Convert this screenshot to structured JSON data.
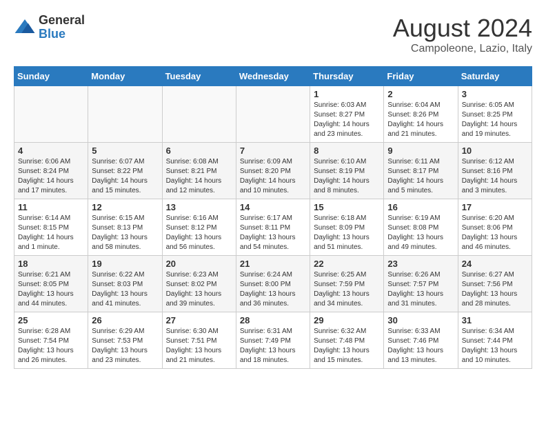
{
  "logo": {
    "general": "General",
    "blue": "Blue"
  },
  "title": {
    "month_year": "August 2024",
    "location": "Campoleone, Lazio, Italy"
  },
  "weekdays": [
    "Sunday",
    "Monday",
    "Tuesday",
    "Wednesday",
    "Thursday",
    "Friday",
    "Saturday"
  ],
  "weeks": [
    [
      {
        "day": "",
        "info": ""
      },
      {
        "day": "",
        "info": ""
      },
      {
        "day": "",
        "info": ""
      },
      {
        "day": "",
        "info": ""
      },
      {
        "day": "1",
        "info": "Sunrise: 6:03 AM\nSunset: 8:27 PM\nDaylight: 14 hours\nand 23 minutes."
      },
      {
        "day": "2",
        "info": "Sunrise: 6:04 AM\nSunset: 8:26 PM\nDaylight: 14 hours\nand 21 minutes."
      },
      {
        "day": "3",
        "info": "Sunrise: 6:05 AM\nSunset: 8:25 PM\nDaylight: 14 hours\nand 19 minutes."
      }
    ],
    [
      {
        "day": "4",
        "info": "Sunrise: 6:06 AM\nSunset: 8:24 PM\nDaylight: 14 hours\nand 17 minutes."
      },
      {
        "day": "5",
        "info": "Sunrise: 6:07 AM\nSunset: 8:22 PM\nDaylight: 14 hours\nand 15 minutes."
      },
      {
        "day": "6",
        "info": "Sunrise: 6:08 AM\nSunset: 8:21 PM\nDaylight: 14 hours\nand 12 minutes."
      },
      {
        "day": "7",
        "info": "Sunrise: 6:09 AM\nSunset: 8:20 PM\nDaylight: 14 hours\nand 10 minutes."
      },
      {
        "day": "8",
        "info": "Sunrise: 6:10 AM\nSunset: 8:19 PM\nDaylight: 14 hours\nand 8 minutes."
      },
      {
        "day": "9",
        "info": "Sunrise: 6:11 AM\nSunset: 8:17 PM\nDaylight: 14 hours\nand 5 minutes."
      },
      {
        "day": "10",
        "info": "Sunrise: 6:12 AM\nSunset: 8:16 PM\nDaylight: 14 hours\nand 3 minutes."
      }
    ],
    [
      {
        "day": "11",
        "info": "Sunrise: 6:14 AM\nSunset: 8:15 PM\nDaylight: 14 hours\nand 1 minute."
      },
      {
        "day": "12",
        "info": "Sunrise: 6:15 AM\nSunset: 8:13 PM\nDaylight: 13 hours\nand 58 minutes."
      },
      {
        "day": "13",
        "info": "Sunrise: 6:16 AM\nSunset: 8:12 PM\nDaylight: 13 hours\nand 56 minutes."
      },
      {
        "day": "14",
        "info": "Sunrise: 6:17 AM\nSunset: 8:11 PM\nDaylight: 13 hours\nand 54 minutes."
      },
      {
        "day": "15",
        "info": "Sunrise: 6:18 AM\nSunset: 8:09 PM\nDaylight: 13 hours\nand 51 minutes."
      },
      {
        "day": "16",
        "info": "Sunrise: 6:19 AM\nSunset: 8:08 PM\nDaylight: 13 hours\nand 49 minutes."
      },
      {
        "day": "17",
        "info": "Sunrise: 6:20 AM\nSunset: 8:06 PM\nDaylight: 13 hours\nand 46 minutes."
      }
    ],
    [
      {
        "day": "18",
        "info": "Sunrise: 6:21 AM\nSunset: 8:05 PM\nDaylight: 13 hours\nand 44 minutes."
      },
      {
        "day": "19",
        "info": "Sunrise: 6:22 AM\nSunset: 8:03 PM\nDaylight: 13 hours\nand 41 minutes."
      },
      {
        "day": "20",
        "info": "Sunrise: 6:23 AM\nSunset: 8:02 PM\nDaylight: 13 hours\nand 39 minutes."
      },
      {
        "day": "21",
        "info": "Sunrise: 6:24 AM\nSunset: 8:00 PM\nDaylight: 13 hours\nand 36 minutes."
      },
      {
        "day": "22",
        "info": "Sunrise: 6:25 AM\nSunset: 7:59 PM\nDaylight: 13 hours\nand 34 minutes."
      },
      {
        "day": "23",
        "info": "Sunrise: 6:26 AM\nSunset: 7:57 PM\nDaylight: 13 hours\nand 31 minutes."
      },
      {
        "day": "24",
        "info": "Sunrise: 6:27 AM\nSunset: 7:56 PM\nDaylight: 13 hours\nand 28 minutes."
      }
    ],
    [
      {
        "day": "25",
        "info": "Sunrise: 6:28 AM\nSunset: 7:54 PM\nDaylight: 13 hours\nand 26 minutes."
      },
      {
        "day": "26",
        "info": "Sunrise: 6:29 AM\nSunset: 7:53 PM\nDaylight: 13 hours\nand 23 minutes."
      },
      {
        "day": "27",
        "info": "Sunrise: 6:30 AM\nSunset: 7:51 PM\nDaylight: 13 hours\nand 21 minutes."
      },
      {
        "day": "28",
        "info": "Sunrise: 6:31 AM\nSunset: 7:49 PM\nDaylight: 13 hours\nand 18 minutes."
      },
      {
        "day": "29",
        "info": "Sunrise: 6:32 AM\nSunset: 7:48 PM\nDaylight: 13 hours\nand 15 minutes."
      },
      {
        "day": "30",
        "info": "Sunrise: 6:33 AM\nSunset: 7:46 PM\nDaylight: 13 hours\nand 13 minutes."
      },
      {
        "day": "31",
        "info": "Sunrise: 6:34 AM\nSunset: 7:44 PM\nDaylight: 13 hours\nand 10 minutes."
      }
    ]
  ]
}
